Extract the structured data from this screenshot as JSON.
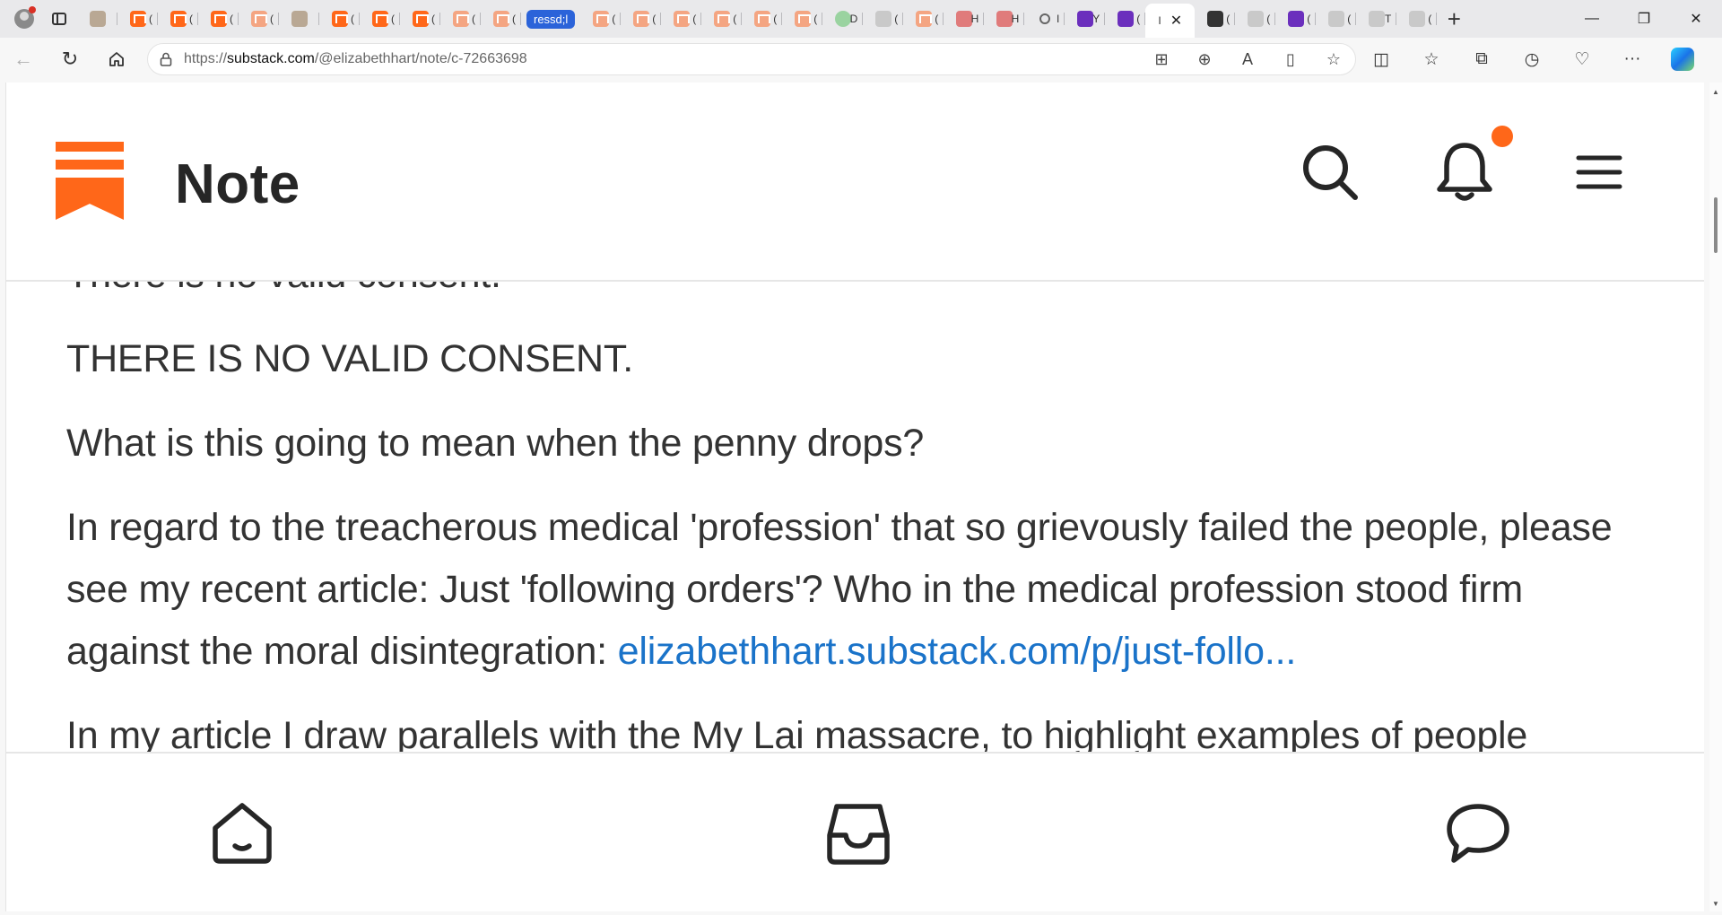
{
  "browser": {
    "tab_group_label": "ressd;l",
    "active_tab_mark": "I",
    "url_prefix": "https://",
    "url_domain": "substack.com",
    "url_path": "/@elizabethhart/note/c-72663698",
    "tabs": [
      {
        "icon": "image-favicon",
        "style": "img",
        "mark": ""
      },
      {
        "icon": "substack-favicon",
        "style": "ss",
        "mark": "("
      },
      {
        "icon": "substack-favicon",
        "style": "ss",
        "mark": "("
      },
      {
        "icon": "substack-favicon",
        "style": "ss",
        "mark": "("
      },
      {
        "icon": "substack-favicon",
        "style": "ssl",
        "mark": "("
      },
      {
        "icon": "image-favicon",
        "style": "img",
        "mark": ""
      },
      {
        "icon": "substack-favicon",
        "style": "ss",
        "mark": "("
      },
      {
        "icon": "substack-favicon",
        "style": "ss",
        "mark": "("
      },
      {
        "icon": "substack-favicon",
        "style": "ss",
        "mark": "("
      },
      {
        "icon": "substack-favicon",
        "style": "ssl",
        "mark": "("
      },
      {
        "icon": "substack-favicon",
        "style": "ssl",
        "mark": "("
      }
    ],
    "tabs_after_group": [
      {
        "icon": "substack-favicon",
        "style": "ssl",
        "mark": "("
      },
      {
        "icon": "substack-favicon",
        "style": "ssl",
        "mark": "("
      },
      {
        "icon": "substack-favicon",
        "style": "ssl",
        "mark": "("
      },
      {
        "icon": "substack-favicon",
        "style": "ssl",
        "mark": "("
      },
      {
        "icon": "substack-favicon",
        "style": "ssl",
        "mark": "("
      },
      {
        "icon": "substack-favicon",
        "style": "ssl",
        "mark": "("
      },
      {
        "icon": "play-favicon",
        "style": "green",
        "mark": "D"
      },
      {
        "icon": "image-favicon",
        "style": "gray",
        "mark": "("
      },
      {
        "icon": "substack-favicon",
        "style": "ssl",
        "mark": "("
      },
      {
        "icon": "podcast-favicon",
        "style": "red",
        "mark": "H"
      },
      {
        "icon": "podcast-favicon",
        "style": "red",
        "mark": "H"
      },
      {
        "icon": "search-favicon",
        "style": "search",
        "mark": "I"
      },
      {
        "icon": "yahoo-favicon",
        "style": "purple",
        "mark": "Y"
      },
      {
        "icon": "mail-favicon",
        "style": "purple",
        "mark": "("
      }
    ],
    "tabs_after_active": [
      {
        "icon": "image-favicon",
        "style": "dark",
        "mark": "("
      },
      {
        "icon": "pen-favicon",
        "style": "gray",
        "mark": "("
      },
      {
        "icon": "yahoo-favicon",
        "style": "purple",
        "mark": "("
      },
      {
        "icon": "doc-favicon",
        "style": "gray",
        "mark": "("
      },
      {
        "icon": "gp-favicon",
        "style": "gray",
        "mark": "T"
      },
      {
        "icon": "doc-favicon",
        "style": "gray",
        "mark": "("
      }
    ]
  },
  "header": {
    "title": "Note"
  },
  "note": {
    "cut_line": "There is no valid consent.",
    "paragraphs": [
      "THERE IS NO VALID CONSENT.",
      "What is this going to mean when the penny drops?"
    ],
    "para3_text": "In regard to the treacherous medical 'profession' that so grievously failed the people, please see my recent article: Just 'following orders'? Who in the medical profession stood firm against the moral disintegration: ",
    "para3_link": "elizabethhart.substack.com/p/just-follo...",
    "para4_text": "In my article I draw parallels with the My Lai massacre, to highlight examples of people"
  },
  "colors": {
    "brand": "#ff6719",
    "link": "#1a73c9",
    "text": "#333333"
  }
}
